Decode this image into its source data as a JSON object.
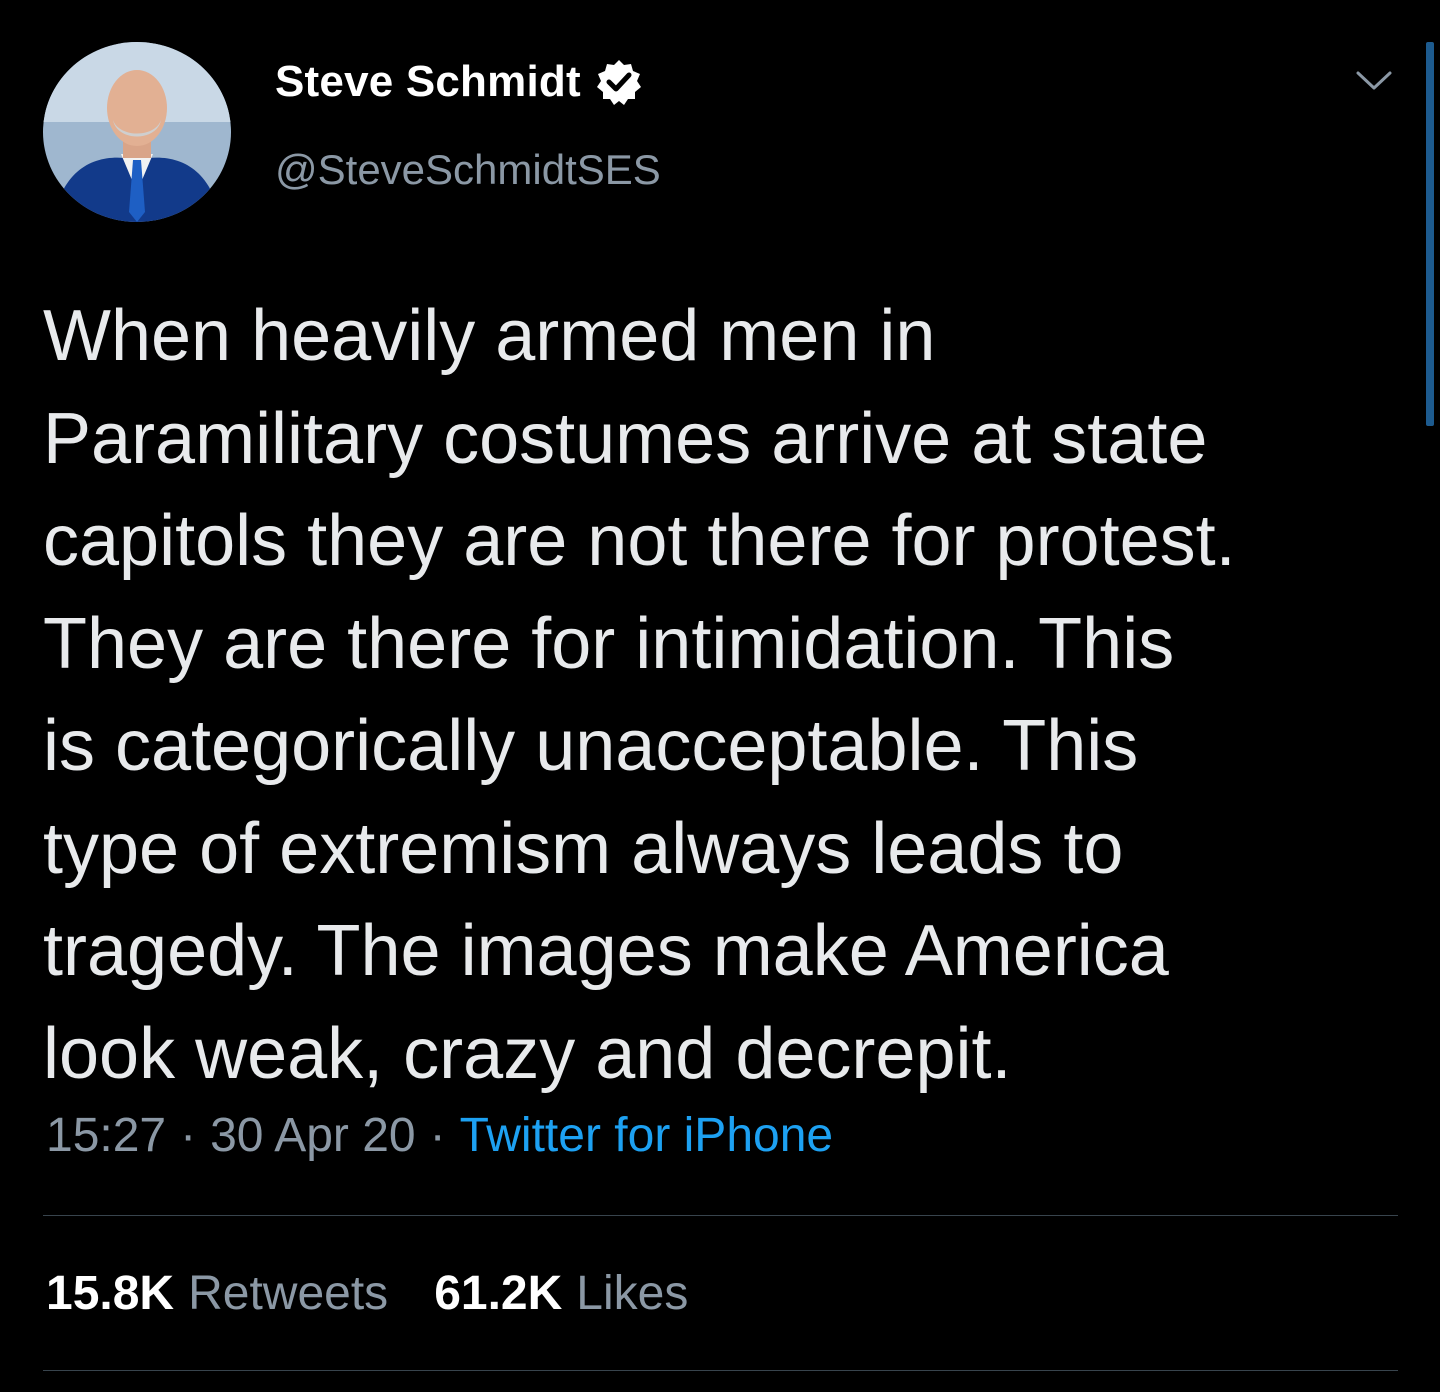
{
  "author": {
    "display_name": "Steve Schmidt",
    "handle": "@SteveSchmidtSES",
    "verified": true
  },
  "icons": {
    "verified": "verified-badge-icon",
    "menu": "chevron-down-icon"
  },
  "tweet": {
    "text": "When heavily armed men in\nParamilitary costumes arrive at state\ncapitols they are not there for protest.\nThey are there for intimidation. This\nis categorically unacceptable. This\ntype of extremism always leads to\ntragedy. The images make America\nlook weak, crazy and decrepit.",
    "time": "15:27",
    "date": "30 Apr 20",
    "separator": "·",
    "source": "Twitter for iPhone"
  },
  "stats": {
    "retweets_count": "15.8K",
    "retweets_label": "Retweets",
    "likes_count": "61.2K",
    "likes_label": "Likes"
  },
  "colors": {
    "background": "#000000",
    "text": "#e8eaec",
    "secondary_text": "#8b98a5",
    "link": "#1da1f2",
    "divider": "#38444d"
  }
}
